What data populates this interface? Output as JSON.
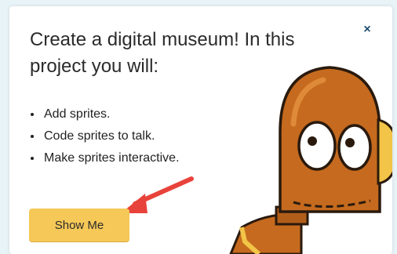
{
  "popup": {
    "title": "Create a digital museum! In this project you will:",
    "close_icon": "×",
    "bullets": [
      "Add sprites.",
      "Code sprites to talk.",
      "Make sprites interactive."
    ],
    "show_me_label": "Show Me"
  },
  "icons": {
    "close": "close-icon",
    "arrow": "pointer-arrow-icon",
    "mascot": "moby-robot-illustration"
  },
  "colors": {
    "button": "#f5c857",
    "arrow": "#e8433a",
    "robot": "#c56a1e",
    "close": "#1f4e73"
  }
}
